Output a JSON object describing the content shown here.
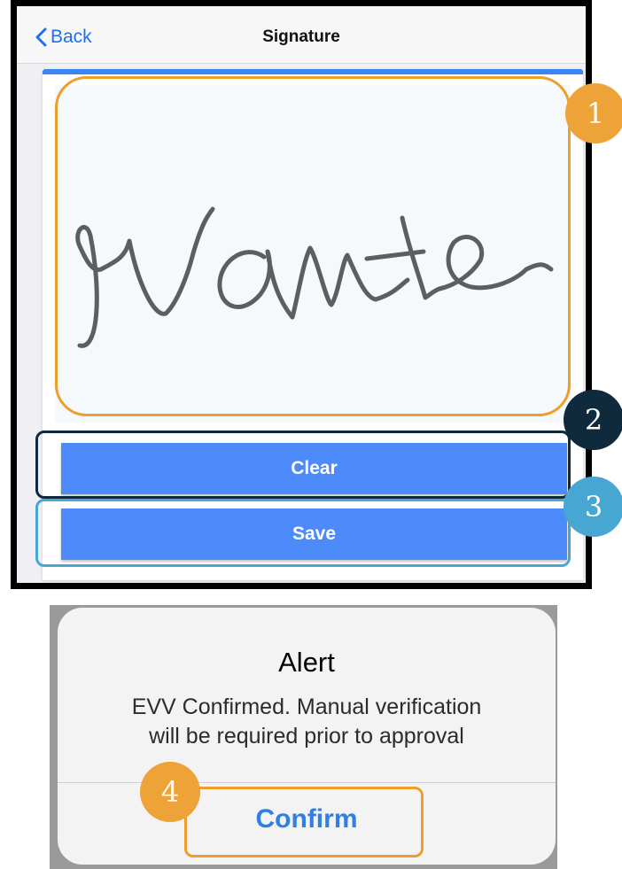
{
  "navbar": {
    "back_label": "Back",
    "title": "Signature"
  },
  "signature_pad": {
    "drawn_text": "Name"
  },
  "buttons": {
    "clear_label": "Clear",
    "save_label": "Save"
  },
  "badges": [
    "1",
    "2",
    "3",
    "4"
  ],
  "alert": {
    "title": "Alert",
    "message_line1": "EVV Confirmed. Manual verification",
    "message_line2": "will be required prior to approval",
    "confirm_label": "Confirm"
  },
  "colors": {
    "accent_blue": "#4d8bfa",
    "link_blue": "#1e6ff5",
    "callout_orange": "#eea338",
    "callout_navy": "#0f2a3d",
    "callout_light_blue": "#48a6d3"
  },
  "icons": {
    "back": "chevron-left-icon"
  }
}
